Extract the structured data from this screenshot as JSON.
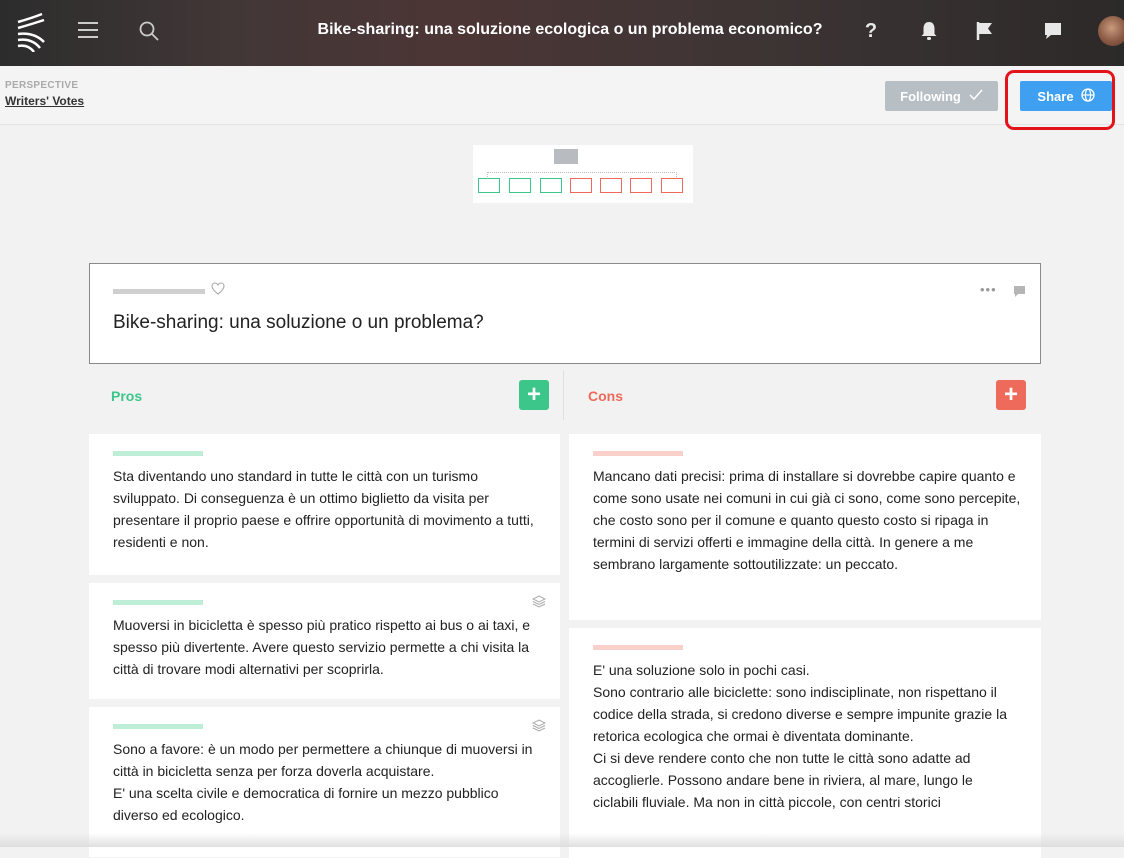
{
  "topbar": {
    "title": "Bike-sharing: una soluzione ecologica o un problema economico?",
    "help_label": "?",
    "icons": [
      "kialo-logo-icon",
      "menu-icon",
      "search-icon",
      "help-icon",
      "bell-icon",
      "flag-icon",
      "chat-icon",
      "avatar"
    ]
  },
  "perspective": {
    "label": "PERSPECTIVE",
    "value": "Writers' Votes",
    "following_label": "Following",
    "share_label": "Share"
  },
  "claim": {
    "text": "Bike-sharing: una soluzione o un problema?",
    "more_label": "•••"
  },
  "pros": {
    "label": "Pros",
    "add_label": "+",
    "cards": [
      {
        "text": "Sta diventando uno standard in tutte le città con un turismo sviluppato. Di conseguenza è un ottimo biglietto da visita per presentare il proprio paese e offrire opportunità di movimento a tutti, residenti e non."
      },
      {
        "text": "Muoversi in bicicletta è spesso più pratico rispetto ai bus o ai taxi, e spesso più divertente. Avere questo servizio permette a chi visita la città di trovare modi alternativi per scoprirla."
      },
      {
        "text": "Sono a favore: è un modo per permettere a chiunque di muoversi in città in bicicletta senza per forza doverla acquistare.\nE' una scelta civile e democratica di fornire un mezzo pubblico diverso ed ecologico."
      }
    ]
  },
  "cons": {
    "label": "Cons",
    "add_label": "+",
    "cards": [
      {
        "text": "Mancano dati precisi: prima di installare si dovrebbe capire quanto e come sono usate nei comuni in cui già ci sono, come sono percepite, che costo sono per il comune e quanto questo costo si ripaga in termini di servizi offerti e immagine della città. In genere a me sembrano largamente sottoutilizzate: un peccato."
      },
      {
        "text": "E' una soluzione solo in pochi casi.\nSono contrario alle biciclette: sono indisciplinate, non rispettano il codice della strada, si credono diverse e sempre impunite grazie la retorica ecologica che ormai è diventata dominante.\nCi si deve rendere conto che non tutte le città sono adatte ad accoglierle. Possono andare bene in riviera, al mare, lungo le ciclabili fluviale. Ma non in città piccole, con centri storici"
      }
    ]
  },
  "colors": {
    "pro": "#3cc68a",
    "con": "#ee6a5a",
    "share": "#3fa0f2",
    "highlight": "#e2141a"
  }
}
